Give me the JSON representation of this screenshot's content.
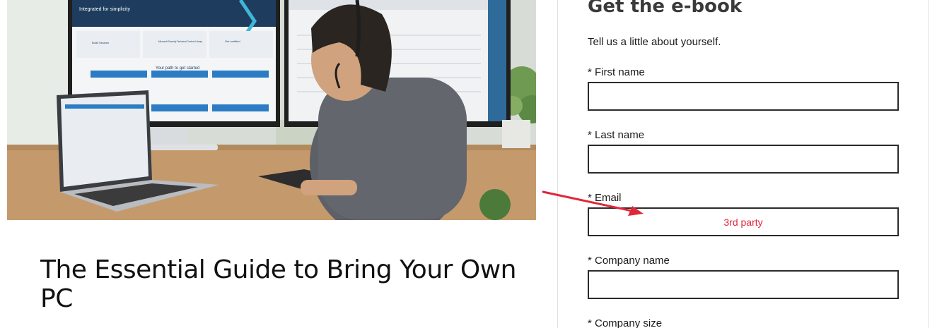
{
  "article": {
    "title": "The Essential Guide to Bring Your Own PC"
  },
  "hero_image": {
    "screen_headline": "Integrated for simplicity",
    "screen_subheading": "Your path to get started",
    "screen_cards": [
      "Build Session",
      "Microsoft Security Technical Content Library",
      "Get certified"
    ]
  },
  "form": {
    "title": "Get the e-book",
    "intro": "Tell us a little about yourself.",
    "fields": [
      {
        "label": "* First name",
        "value": ""
      },
      {
        "label": "* Last name",
        "value": ""
      },
      {
        "label": "* Email",
        "value": "3rd party"
      },
      {
        "label": "* Company name",
        "value": ""
      },
      {
        "label": "* Company size",
        "value": ""
      }
    ]
  },
  "colors": {
    "annotation": "#e0273a",
    "input_border": "#2b2b2b",
    "screen_blue": "#2b7cc4"
  }
}
